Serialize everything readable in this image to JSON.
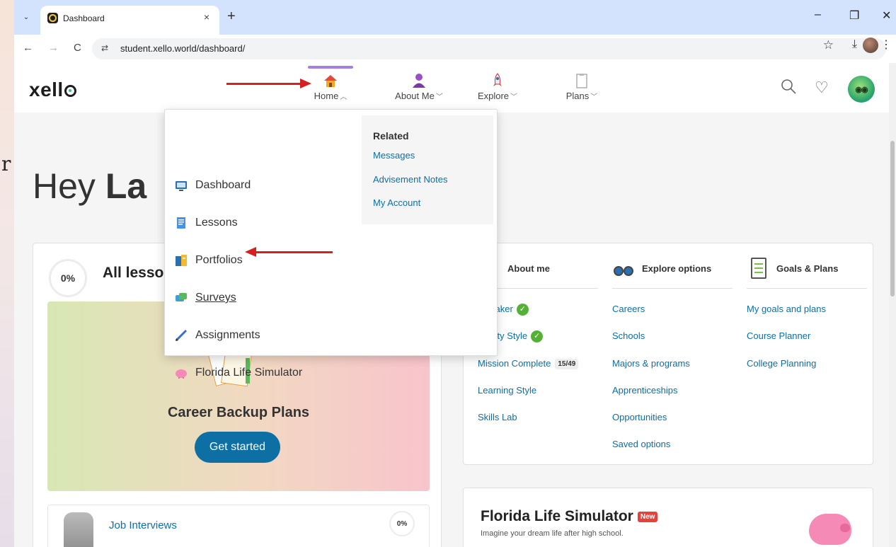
{
  "browser": {
    "tab_title": "Dashboard",
    "tab_close": "×",
    "new_tab": "+",
    "tab_menu": "⌄",
    "url": "student.xello.world/dashboard/",
    "minimize": "–",
    "restore": "❐",
    "close": "✕",
    "back": "←",
    "forward": "→",
    "reload": "C",
    "site_info": "⇄",
    "star": "☆",
    "download": "⤓",
    "menu": "⋮"
  },
  "left_glyph": "r",
  "app": {
    "logo": "xell",
    "nav": [
      {
        "label": "Home",
        "icon": "house-icon",
        "caret": "︿"
      },
      {
        "label": "About Me",
        "icon": "person-icon",
        "caret": "﹀"
      },
      {
        "label": "Explore",
        "icon": "rocket-icon",
        "caret": "﹀"
      },
      {
        "label": "Plans",
        "icon": "clipboard-icon",
        "caret": "﹀"
      }
    ],
    "heart": "♡",
    "avatar": "◉◉"
  },
  "greeting": {
    "prefix": "Hey ",
    "name": "La"
  },
  "home_menu": {
    "items": [
      {
        "label": "Dashboard",
        "icon": "monitor-icon"
      },
      {
        "label": "Lessons",
        "icon": "document-icon"
      },
      {
        "label": "Portfolios",
        "icon": "portfolio-icon"
      },
      {
        "label": "Surveys",
        "icon": "survey-icon"
      },
      {
        "label": "Assignments",
        "icon": "pencil-icon"
      },
      {
        "label": "Florida Life Simulator",
        "icon": "piggy-bank-icon"
      }
    ],
    "related": {
      "heading": "Related",
      "links": [
        "Messages",
        "Advisement Notes",
        "My Account"
      ]
    }
  },
  "lessons": {
    "progress": "0%",
    "title": "All lesso",
    "featured_title": "Career Backup Plans",
    "featured_button": "Get started",
    "row_label": "Job Interviews",
    "row_progress": "0%"
  },
  "links": {
    "about_me": {
      "heading": "About me",
      "items": [
        "chmaker",
        "onality Style",
        "Mission Complete",
        "Learning Style",
        "Skills Lab"
      ],
      "mission_count": "15/49",
      "check": "✓"
    },
    "explore": {
      "heading": "Explore options",
      "items": [
        "Careers",
        "Schools",
        "Majors & programs",
        "Apprenticeships",
        "Opportunities",
        "Saved options"
      ]
    },
    "goals": {
      "heading": "Goals & Plans",
      "items": [
        "My goals and plans",
        "Course Planner",
        "College Planning"
      ]
    }
  },
  "simulator": {
    "title": "Florida Life Simulator",
    "badge": "New",
    "subtitle": "Imagine your dream life after high school."
  },
  "colors": {
    "accent": "#0d6fa4",
    "active_tab": "#a77fe0",
    "annotation": "#d61f1f"
  }
}
